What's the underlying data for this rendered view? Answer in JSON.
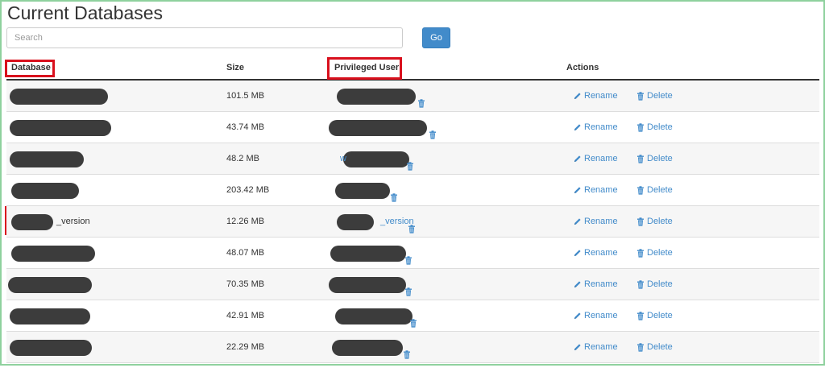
{
  "page": {
    "title": "Current Databases"
  },
  "search": {
    "placeholder": "Search",
    "go_label": "Go"
  },
  "table": {
    "headers": {
      "database": "Database",
      "size": "Size",
      "privileged_user": "Privileged User",
      "actions": "Actions"
    },
    "rows": [
      {
        "database": "",
        "size": "101.5 MB",
        "user": "",
        "rename": "Rename",
        "delete": "Delete"
      },
      {
        "database": "",
        "size": "43.74 MB",
        "user": "",
        "rename": "Rename",
        "delete": "Delete"
      },
      {
        "database": "",
        "size": "48.2 MB",
        "user": "w",
        "rename": "Rename",
        "delete": "Delete"
      },
      {
        "database": "",
        "size": "203.42 MB",
        "user": "",
        "rename": "Rename",
        "delete": "Delete"
      },
      {
        "database": "_version",
        "size": "12.26 MB",
        "user": "_version",
        "rename": "Rename",
        "delete": "Delete"
      },
      {
        "database": "",
        "size": "48.07 MB",
        "user": "",
        "rename": "Rename",
        "delete": "Delete"
      },
      {
        "database": "",
        "size": "70.35 MB",
        "user": "",
        "rename": "Rename",
        "delete": "Delete"
      },
      {
        "database": "",
        "size": "42.91 MB",
        "user": "",
        "rename": "Rename",
        "delete": "Delete"
      },
      {
        "database": "",
        "size": "22.29 MB",
        "user": "",
        "rename": "Rename",
        "delete": "Delete"
      }
    ]
  },
  "colors": {
    "link": "#428bca",
    "highlight_box": "#d9101d",
    "frame": "#8fd19e",
    "redaction": "#3c3c3c"
  },
  "icons": {
    "rename": "pencil-icon",
    "delete": "trash-icon"
  }
}
